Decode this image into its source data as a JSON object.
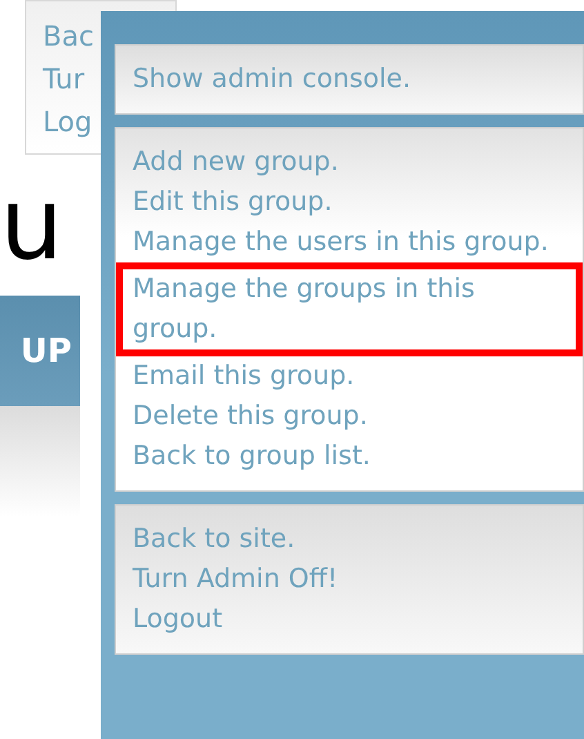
{
  "background_menu": {
    "items": [
      "Bac",
      "Tur",
      "Log"
    ]
  },
  "heading": "u",
  "button": {
    "label": "UP"
  },
  "admin_menu": {
    "sections": [
      {
        "items": [
          {
            "label": "Show admin console.",
            "highlighted": false
          }
        ]
      },
      {
        "items": [
          {
            "label": "Add new group.",
            "highlighted": false
          },
          {
            "label": "Edit this group.",
            "highlighted": false
          },
          {
            "label": "Manage the users in this group.",
            "highlighted": false
          },
          {
            "label": "Manage the groups in this group.",
            "highlighted": true
          },
          {
            "label": "Email this group.",
            "highlighted": false
          },
          {
            "label": "Delete this group.",
            "highlighted": false
          },
          {
            "label": "Back to group list.",
            "highlighted": false
          }
        ]
      },
      {
        "items": [
          {
            "label": "Back to site.",
            "highlighted": false
          },
          {
            "label": "Turn Admin Off!",
            "highlighted": false
          },
          {
            "label": "Logout",
            "highlighted": false
          }
        ]
      }
    ]
  }
}
